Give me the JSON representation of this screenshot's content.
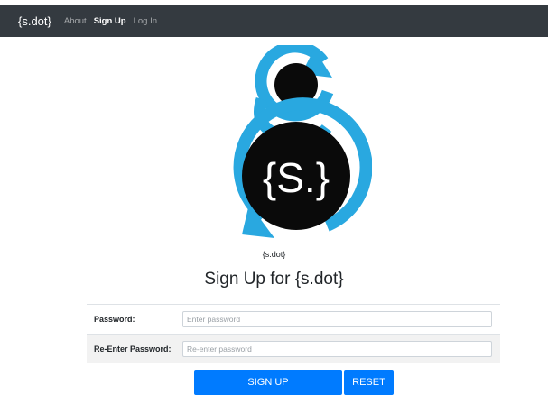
{
  "navbar": {
    "brand": "{s.dot}",
    "links": [
      {
        "label": "About",
        "active": false
      },
      {
        "label": "Sign Up",
        "active": true
      },
      {
        "label": "Log In",
        "active": false
      }
    ]
  },
  "logo": {
    "text": "{S.}",
    "caption": "{s.dot}",
    "colors": {
      "ring": "#29a8e0",
      "disc": "#0a0a0a",
      "accent": "#29a8e0"
    }
  },
  "heading": "Sign Up for {s.dot}",
  "form": {
    "password": {
      "label": "Password:",
      "placeholder": "Enter password",
      "value": ""
    },
    "reenter": {
      "label": "Re-Enter Password:",
      "placeholder": "Re-enter password",
      "value": ""
    }
  },
  "buttons": {
    "signup": "SIGN UP",
    "reset": "RESET"
  },
  "colors": {
    "navbar": "#343a40",
    "primary": "#007bff"
  }
}
